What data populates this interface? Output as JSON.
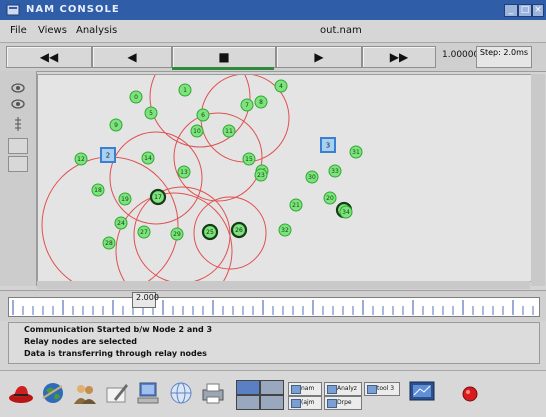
{
  "window": {
    "title": "NAM CONSOLE",
    "buttons": [
      "_",
      "□",
      "×"
    ]
  },
  "menubar": {
    "items": [
      "File",
      "Views",
      "Analysis"
    ],
    "filename": "out.nam"
  },
  "toolbar": {
    "rewind_label": "◀◀",
    "back_label": "◀",
    "stop_label": "■",
    "play_label": "▶",
    "fastforward_label": "▶▶",
    "time_readout": "1.000000",
    "step_label": "Step: 2.0ms"
  },
  "left_tools": {
    "zoom_in_icon": "eye-zoom-in-icon",
    "zoom_out_icon": "eye-zoom-out-icon",
    "scale_icon": "ruler-icon"
  },
  "topology": {
    "node_color": "#7ee27e",
    "node_border": "#2fa82f",
    "range_circle_color": "#e05050",
    "relay_node_fill": "#2d6a2d",
    "source_dest_color": "#3b7fd0",
    "nodes": [
      {
        "label": "0"
      },
      {
        "label": "1"
      },
      {
        "label": "2"
      },
      {
        "label": "3"
      },
      {
        "label": "4"
      },
      {
        "label": "5"
      },
      {
        "label": "6"
      },
      {
        "label": "7"
      },
      {
        "label": "8"
      },
      {
        "label": "9"
      },
      {
        "label": "10"
      },
      {
        "label": "11"
      },
      {
        "label": "12"
      },
      {
        "label": "13"
      },
      {
        "label": "14"
      },
      {
        "label": "15"
      },
      {
        "label": "16"
      },
      {
        "label": "17"
      },
      {
        "label": "18"
      },
      {
        "label": "19"
      },
      {
        "label": "20"
      },
      {
        "label": "21"
      },
      {
        "label": "22"
      },
      {
        "label": "23"
      },
      {
        "label": "24"
      },
      {
        "label": "25"
      },
      {
        "label": "26"
      },
      {
        "label": "27"
      },
      {
        "label": "28"
      },
      {
        "label": "29"
      },
      {
        "label": "30"
      },
      {
        "label": "31"
      },
      {
        "label": "32"
      },
      {
        "label": "33"
      },
      {
        "label": "34"
      }
    ],
    "source_node": "2",
    "destination_node": "3",
    "relay_nodes": [
      "17",
      "22",
      "25",
      "26"
    ]
  },
  "timeline": {
    "label": "2.000"
  },
  "status": {
    "lines": [
      "Communication Started b/w Node 2 and 3",
      "Relay nodes are selected",
      "Data is transferring through relay nodes"
    ]
  },
  "taskbar": {
    "icons": [
      "redhat-icon",
      "globe-icon",
      "people-icon",
      "pen-icon",
      "computer-icon",
      "network-icon",
      "printer-icon"
    ],
    "workspace_colors": [
      "#5a7fc2",
      "#9aa8bf",
      "#9aa8bf",
      "#9aa8bf"
    ],
    "buttons": [
      "nam",
      "Analyz",
      "tool 3",
      "(ajm",
      "Drpe"
    ],
    "right_icons": [
      "monitor-icon",
      "power-icon"
    ]
  }
}
